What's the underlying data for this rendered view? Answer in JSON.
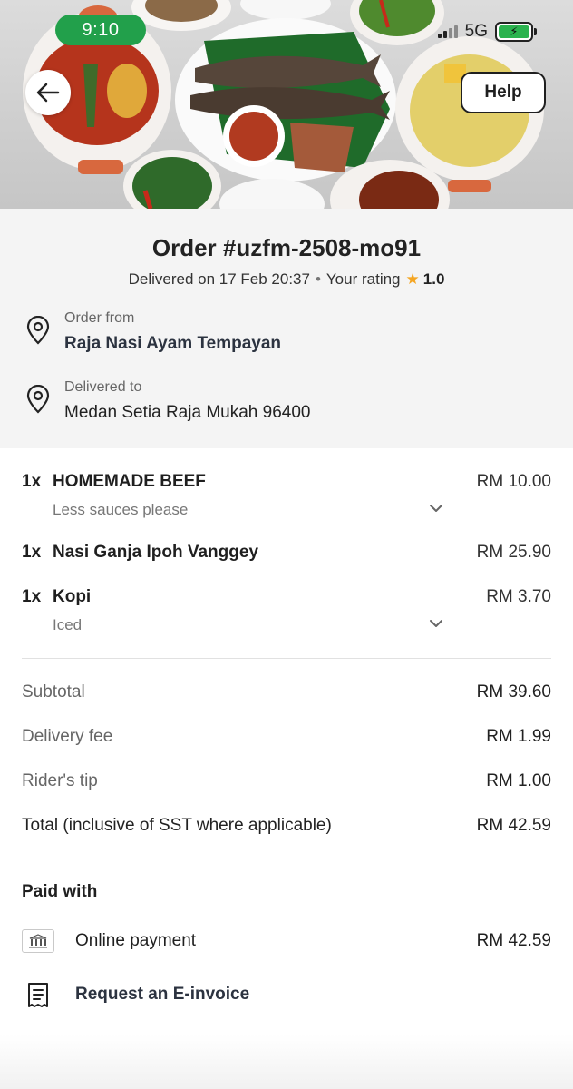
{
  "status_bar": {
    "time": "9:10",
    "network": "5G"
  },
  "header": {
    "help_label": "Help"
  },
  "order": {
    "title": "Order #uzfm-2508-mo91",
    "delivered_text": "Delivered on 17 Feb 20:37",
    "rating_label": "Your rating",
    "rating_value": "1.0",
    "from_label": "Order from",
    "from_value": "Raja Nasi Ayam Tempayan",
    "to_label": "Delivered to",
    "to_value": "Medan Setia Raja Mukah 96400"
  },
  "items": [
    {
      "qty": "1x",
      "name": "HOMEMADE BEEF",
      "price": "RM 10.00",
      "note": "Less sauces please"
    },
    {
      "qty": "1x",
      "name": "Nasi Ganja Ipoh Vanggey",
      "price": "RM 25.90"
    },
    {
      "qty": "1x",
      "name": "Kopi",
      "price": "RM 3.70",
      "note": "Iced"
    }
  ],
  "summary": {
    "subtotal_label": "Subtotal",
    "subtotal_value": "RM 39.60",
    "delivery_label": "Delivery fee",
    "delivery_value": "RM 1.99",
    "tip_label": "Rider's tip",
    "tip_value": "RM 1.00",
    "total_label": "Total (inclusive of SST where applicable)",
    "total_value": "RM 42.59"
  },
  "payment": {
    "title": "Paid with",
    "method": "Online payment",
    "amount": "RM 42.59",
    "einvoice_label": "Request an E-invoice"
  },
  "colors": {
    "accent_green": "#22a04b",
    "star": "#f5a623",
    "text_dark": "#222222",
    "muted": "#666666"
  },
  "icons": [
    "back-arrow-icon",
    "location-pin-icon",
    "chevron-down-icon",
    "star-icon",
    "bank-icon",
    "receipt-icon",
    "battery-icon",
    "signal-icon"
  ]
}
